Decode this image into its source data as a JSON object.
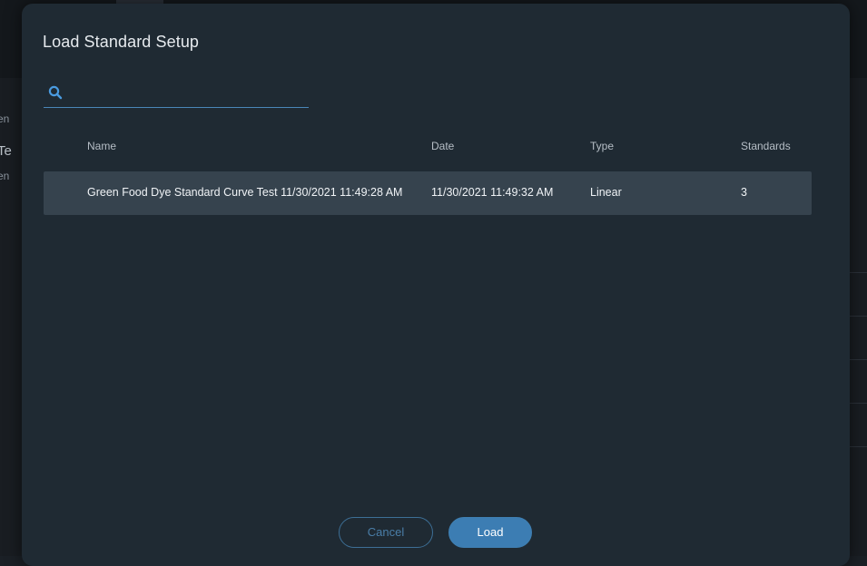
{
  "background": {
    "left_fragments": [
      "en",
      "Te",
      "en"
    ]
  },
  "dialog": {
    "title": "Load Standard Setup",
    "search": {
      "value": "",
      "placeholder": "",
      "icon": "search-icon"
    },
    "table": {
      "columns": [
        "Name",
        "Date",
        "Type",
        "Standards"
      ],
      "rows": [
        {
          "name": "Green Food Dye Standard Curve Test 11/30/2021 11:49:28 AM",
          "date": "11/30/2021 11:49:32 AM",
          "type": "Linear",
          "standards": "3"
        }
      ]
    },
    "buttons": {
      "cancel": "Cancel",
      "load": "Load"
    }
  },
  "colors": {
    "dialog_bg": "#1f2a33",
    "selected_row": "#36434e",
    "accent": "#3c7db3"
  }
}
